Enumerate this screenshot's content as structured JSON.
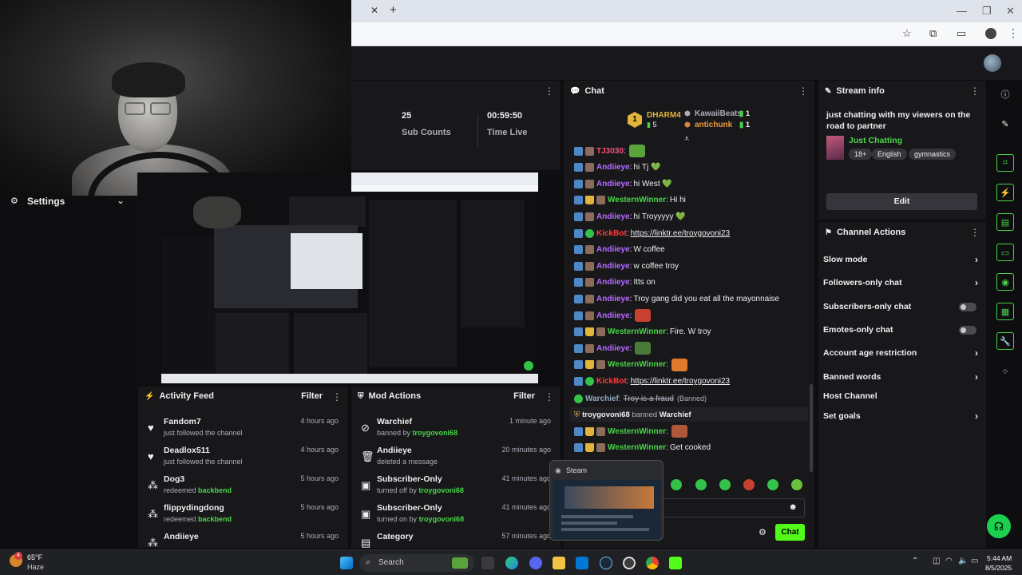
{
  "browser": {
    "tab_close": "✕",
    "tab_add": "+",
    "win_min": "—",
    "win_max": "❐",
    "win_close": "✕"
  },
  "settings": {
    "label": "Settings"
  },
  "stats": {
    "sub_counts_value": "25",
    "sub_counts_label": "Sub Counts",
    "time_live_value": "00:59:50",
    "time_live_label": "Time Live"
  },
  "activity_feed": {
    "title": "Activity Feed",
    "filter": "Filter",
    "items": [
      {
        "name": "Fandom7",
        "sub": "just followed the channel",
        "time": "4 hours ago",
        "icon": "heart-icon"
      },
      {
        "name": "Deadlox511",
        "sub": "just followed the channel",
        "time": "4 hours ago",
        "icon": "heart-icon"
      },
      {
        "name": "Dog3",
        "sub_prefix": "redeemed",
        "sub_highlight": "backbend",
        "time": "5 hours ago",
        "icon": "points-icon"
      },
      {
        "name": "flippydingdong",
        "sub_prefix": "redeemed",
        "sub_highlight": "backbend",
        "time": "5 hours ago",
        "icon": "points-icon"
      },
      {
        "name": "Andiieye",
        "time": "5 hours ago",
        "icon": "points-icon"
      }
    ]
  },
  "mod_actions": {
    "title": "Mod Actions",
    "filter": "Filter",
    "items": [
      {
        "name": "Warchief",
        "sub_prefix": "banned by",
        "sub_highlight": "troygovoni68",
        "time": "1 minute ago",
        "icon": "ban-icon"
      },
      {
        "name": "Andiieye",
        "sub": "deleted a message",
        "time": "20 minutes ago",
        "icon": "trash-icon"
      },
      {
        "name": "Subscriber-Only",
        "sub_prefix": "turned off by",
        "sub_highlight": "troygovoni68",
        "time": "41 minutes ago",
        "icon": "gift-icon"
      },
      {
        "name": "Subscriber-Only",
        "sub_prefix": "turned on by",
        "sub_highlight": "troygovoni68",
        "time": "41 minutes ago",
        "icon": "gift-icon"
      },
      {
        "name": "Category",
        "time": "57 minutes ago",
        "icon": "category-icon"
      }
    ]
  },
  "chat": {
    "title": "Chat",
    "leaderboard": {
      "rank": "1",
      "first_name": "DHARM4",
      "first_count": "5",
      "second_name": "KawaiiBeats",
      "second_count": "1",
      "third_name": "antichunk",
      "third_count": "1"
    },
    "messages": [
      {
        "user": "TJ3030",
        "color": "#ff4d7a",
        "text": "",
        "emote": "#5aa33a"
      },
      {
        "user": "Andiieye",
        "color": "#b66bff",
        "text": "hi Tj 💚"
      },
      {
        "user": "Andiieye",
        "color": "#b66bff",
        "text": "hi West 💚"
      },
      {
        "user": "WesternWinner",
        "color": "#49d449",
        "text": "Hi hi"
      },
      {
        "user": "Andiieye",
        "color": "#b66bff",
        "text": "hi Troyyyyy 💚"
      },
      {
        "user": "KickBot",
        "color": "#ff3b3b",
        "link": "https://linktr.ee/troygovoni23"
      },
      {
        "user": "Andiieye",
        "color": "#b66bff",
        "text": "W coffee"
      },
      {
        "user": "Andiieye",
        "color": "#b66bff",
        "text": "w coffee troy"
      },
      {
        "user": "Andiieye",
        "color": "#b66bff",
        "text": "Itts on"
      },
      {
        "user": "Andiieye",
        "color": "#b66bff",
        "text": "Troy gang did you eat all the mayonnaise"
      },
      {
        "user": "Andiieye",
        "color": "#b66bff",
        "text": "",
        "emote": "#c8402f"
      },
      {
        "user": "WesternWinner",
        "color": "#49d449",
        "text": "Fire. W troy"
      },
      {
        "user": "Andiieye",
        "color": "#b66bff",
        "text": "",
        "emote": "#4a7a3a"
      },
      {
        "user": "WesternWinner",
        "color": "#49d449",
        "text": "",
        "emote": "#e07a2a"
      },
      {
        "user": "KickBot",
        "color": "#ff3b3b",
        "link": "https://linktr.ee/troygovoni23"
      }
    ],
    "banned_line": {
      "user": "Warchief",
      "text": "Troy is a fraud",
      "tag": "(Banned)"
    },
    "ban_notice": {
      "mod": "troygovoni68",
      "action": "banned",
      "target": "Warchief"
    },
    "after_messages": [
      {
        "user": "WesternWinner",
        "color": "#49d449",
        "text": "",
        "emote": "#b0573a"
      },
      {
        "user": "WesternWinner",
        "color": "#49d449",
        "text": "Get cooked"
      }
    ],
    "send_button": "Chat"
  },
  "steam_popup": {
    "title": "Steam"
  },
  "stream_info": {
    "title": "Stream info",
    "stream_title": "just chatting with my viewers on the road to partner",
    "category": "Just Chatting",
    "tags": [
      "18+",
      "English",
      "gymnastics"
    ],
    "edit": "Edit"
  },
  "channel_actions": {
    "title": "Channel Actions",
    "items": [
      {
        "label": "Slow mode",
        "control": "chevron"
      },
      {
        "label": "Followers-only chat",
        "control": "chevron"
      },
      {
        "label": "Subscribers-only chat",
        "control": "toggle"
      },
      {
        "label": "Emotes-only chat",
        "control": "toggle"
      },
      {
        "label": "Account age restriction",
        "control": "chevron"
      },
      {
        "label": "Banned words",
        "control": "chevron"
      },
      {
        "label": "Host Channel",
        "control": "none"
      },
      {
        "label": "Set goals",
        "control": "chevron"
      }
    ]
  },
  "taskbar": {
    "weather_temp": "65°F",
    "weather_desc": "Haze",
    "weather_badge": "4",
    "search": "Search",
    "time": "5:44 AM",
    "date": "8/5/2025"
  }
}
